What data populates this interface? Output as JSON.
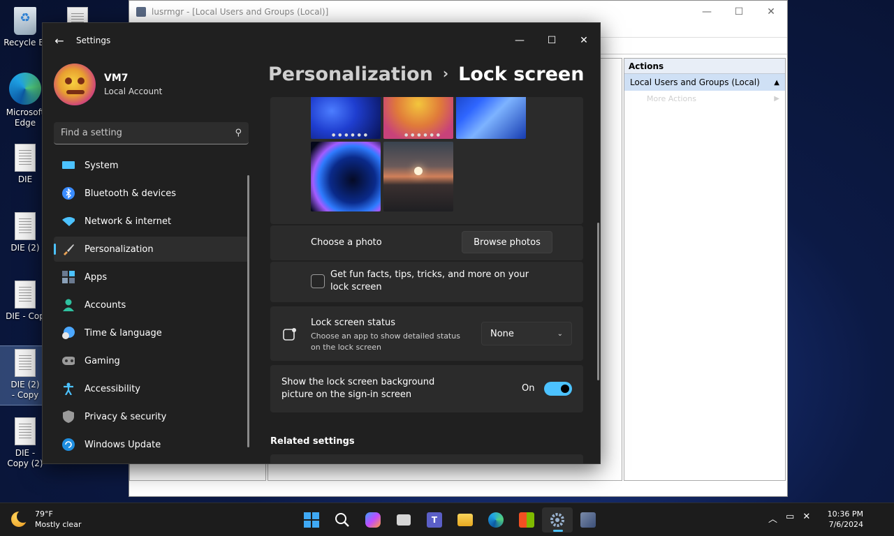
{
  "desktop": {
    "icons": [
      {
        "label": "Recycle Bi"
      },
      {
        "label": "Microsoft Edge"
      },
      {
        "label": "DIE"
      },
      {
        "label": "DIE (2)"
      },
      {
        "label": "DIE - Cop"
      },
      {
        "label": "DIE (2) - Copy"
      },
      {
        "label": "DIE - Copy (2)"
      }
    ]
  },
  "mmc": {
    "title": "lusrmgr - [Local Users and Groups (Local)]",
    "actions_header": "Actions",
    "actions_selected": "Local Users and Groups (Local)",
    "actions_more": "More Actions"
  },
  "settings": {
    "window_title": "Settings",
    "profile": {
      "name": "VM7",
      "account_type": "Local Account"
    },
    "search_placeholder": "Find a setting",
    "nav": [
      {
        "label": "System",
        "icon": "monitor-icon",
        "color": "#4cc2ff"
      },
      {
        "label": "Bluetooth & devices",
        "icon": "bluetooth-icon",
        "color": "#3a8cff"
      },
      {
        "label": "Network & internet",
        "icon": "wifi-icon",
        "color": "#4cc2ff"
      },
      {
        "label": "Personalization",
        "icon": "paintbrush-icon",
        "color": "#e8a256",
        "active": true
      },
      {
        "label": "Apps",
        "icon": "apps-icon",
        "color": "#8aa0b8"
      },
      {
        "label": "Accounts",
        "icon": "person-icon",
        "color": "#2fc1a0"
      },
      {
        "label": "Time & language",
        "icon": "globe-clock-icon",
        "color": "#4ca8ff"
      },
      {
        "label": "Gaming",
        "icon": "gamepad-icon",
        "color": "#9a9a9a"
      },
      {
        "label": "Accessibility",
        "icon": "accessibility-icon",
        "color": "#4cc2ff"
      },
      {
        "label": "Privacy & security",
        "icon": "shield-icon",
        "color": "#9a9a9a"
      },
      {
        "label": "Windows Update",
        "icon": "refresh-icon",
        "color": "#4cc2ff"
      }
    ],
    "breadcrumb": {
      "parent": "Personalization",
      "separator": "›",
      "current": "Lock screen"
    },
    "choose_photo": {
      "label": "Choose a photo",
      "button": "Browse photos"
    },
    "fun_facts": {
      "label": "Get fun facts, tips, tricks, and more on your lock screen",
      "checked": false
    },
    "lock_status": {
      "title": "Lock screen status",
      "description": "Choose an app to show detailed status on the lock screen",
      "value": "None"
    },
    "signin_bg": {
      "label": "Show the lock screen background picture on the sign-in screen",
      "state_label": "On",
      "enabled": true
    },
    "related_settings": "Related settings"
  },
  "taskbar": {
    "weather": {
      "temp": "79°F",
      "condition": "Mostly clear"
    },
    "clock": {
      "time": "10:36 PM",
      "date": "7/6/2024"
    },
    "apps": [
      "start-icon",
      "search-icon",
      "copilot-icon",
      "task-view-icon",
      "teams-icon",
      "file-explorer-icon",
      "edge-icon",
      "store-icon",
      "settings-icon",
      "lusrmgr-icon"
    ]
  },
  "colors": {
    "accent": "#4cc2ff",
    "window_bg": "#202020",
    "card_bg": "#2b2b2b"
  }
}
